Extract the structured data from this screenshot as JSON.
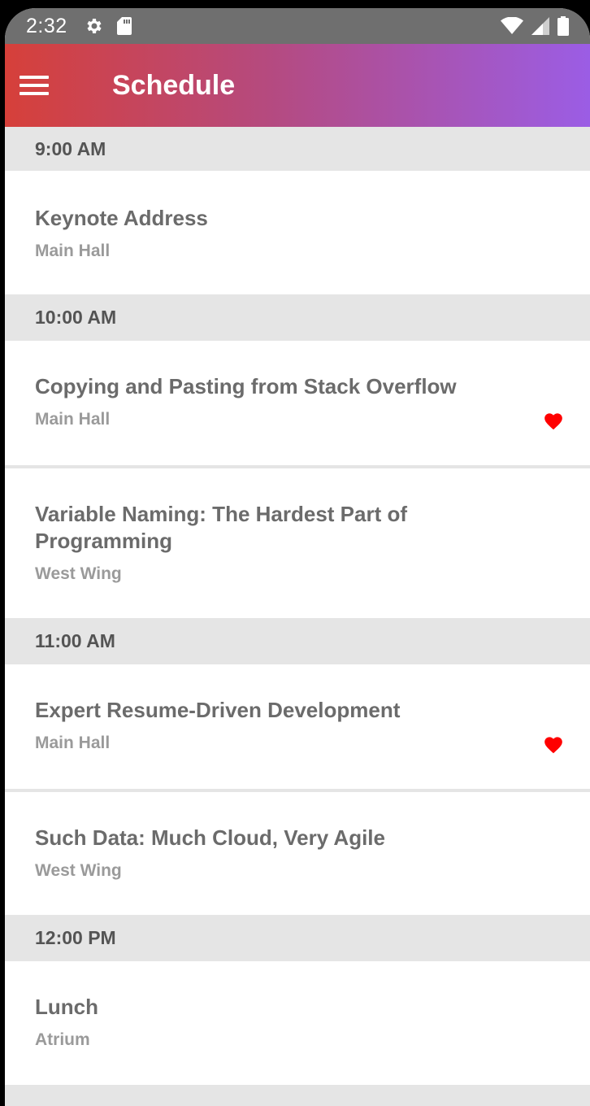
{
  "status_bar": {
    "time": "2:32",
    "icons": [
      "settings-icon",
      "sd-card-icon",
      "wifi-icon",
      "cell-signal-icon",
      "battery-icon"
    ]
  },
  "app_bar": {
    "menu_icon": "hamburger-menu-icon",
    "title": "Schedule",
    "gradient": [
      "#d6403a",
      "#b54a7f",
      "#9b5de5"
    ]
  },
  "schedule": {
    "groups": [
      {
        "time": "9:00 AM",
        "sessions": [
          {
            "title": "Keynote Address",
            "room": "Main Hall",
            "favorite": false
          }
        ]
      },
      {
        "time": "10:00 AM",
        "sessions": [
          {
            "title": "Copying and Pasting from Stack Overflow",
            "room": "Main Hall",
            "favorite": true
          },
          {
            "title": "Variable Naming: The Hardest Part of Programming",
            "room": "West Wing",
            "favorite": false
          }
        ]
      },
      {
        "time": "11:00 AM",
        "sessions": [
          {
            "title": "Expert Resume-Driven Development",
            "room": "Main Hall",
            "favorite": true
          },
          {
            "title": "Such Data: Much Cloud, Very Agile",
            "room": "West Wing",
            "favorite": false
          }
        ]
      },
      {
        "time": "12:00 PM",
        "sessions": [
          {
            "title": "Lunch",
            "room": "Atrium",
            "favorite": false
          }
        ]
      }
    ]
  },
  "colors": {
    "favorite": "#ff0000",
    "header_bg": "#e5e5e5",
    "title_text": "#6b6b6b",
    "room_text": "#9a9a9a"
  }
}
